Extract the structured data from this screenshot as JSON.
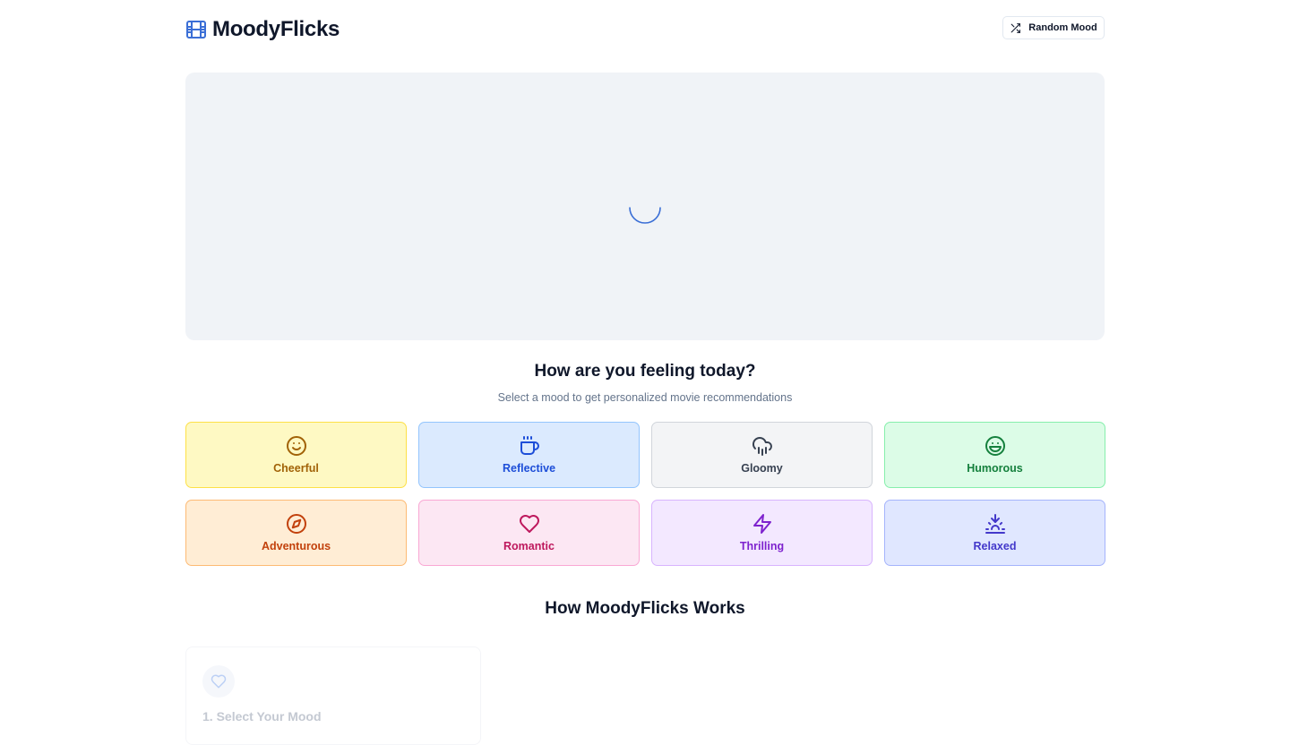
{
  "header": {
    "brand": "MoodyFlicks",
    "brand_icon": "film-icon",
    "random_button_label": "Random Mood",
    "random_button_icon": "shuffle-icon"
  },
  "hero": {
    "state": "loading",
    "spinner_icon": "loading-spinner-icon"
  },
  "mood_section": {
    "title": "How are you feeling today?",
    "subtitle": "Select a mood to get personalized movie recommendations",
    "moods": [
      {
        "label": "Cheerful",
        "icon": "smile-icon",
        "bg": "#fef9c3",
        "border": "#fde047",
        "color": "#a16207"
      },
      {
        "label": "Reflective",
        "icon": "coffee-icon",
        "bg": "#dbeafe",
        "border": "#93c5fd",
        "color": "#1d4ed8"
      },
      {
        "label": "Gloomy",
        "icon": "cloud-rain-icon",
        "bg": "#f3f4f6",
        "border": "#d1d5db",
        "color": "#374151"
      },
      {
        "label": "Humorous",
        "icon": "laugh-icon",
        "bg": "#dcfce7",
        "border": "#86efac",
        "color": "#15803d"
      },
      {
        "label": "Adventurous",
        "icon": "compass-icon",
        "bg": "#ffedd5",
        "border": "#fdba74",
        "color": "#c2410c"
      },
      {
        "label": "Romantic",
        "icon": "heart-icon",
        "bg": "#fce7f3",
        "border": "#f9a8d4",
        "color": "#be185d"
      },
      {
        "label": "Thrilling",
        "icon": "zap-icon",
        "bg": "#f3e8ff",
        "border": "#d8b4fe",
        "color": "#7e22ce"
      },
      {
        "label": "Relaxed",
        "icon": "sunset-icon",
        "bg": "#e0e7ff",
        "border": "#a5b4fc",
        "color": "#4338ca"
      }
    ]
  },
  "how_it_works": {
    "title": "How MoodyFlicks Works",
    "steps": [
      {
        "title": "1. Select Your Mood",
        "icon": "heart-icon"
      }
    ]
  },
  "colors": {
    "accent": "#3b6fd6",
    "hero_bg": "#f0f3f7",
    "text_primary": "#0f172a",
    "text_muted": "#64748b"
  }
}
